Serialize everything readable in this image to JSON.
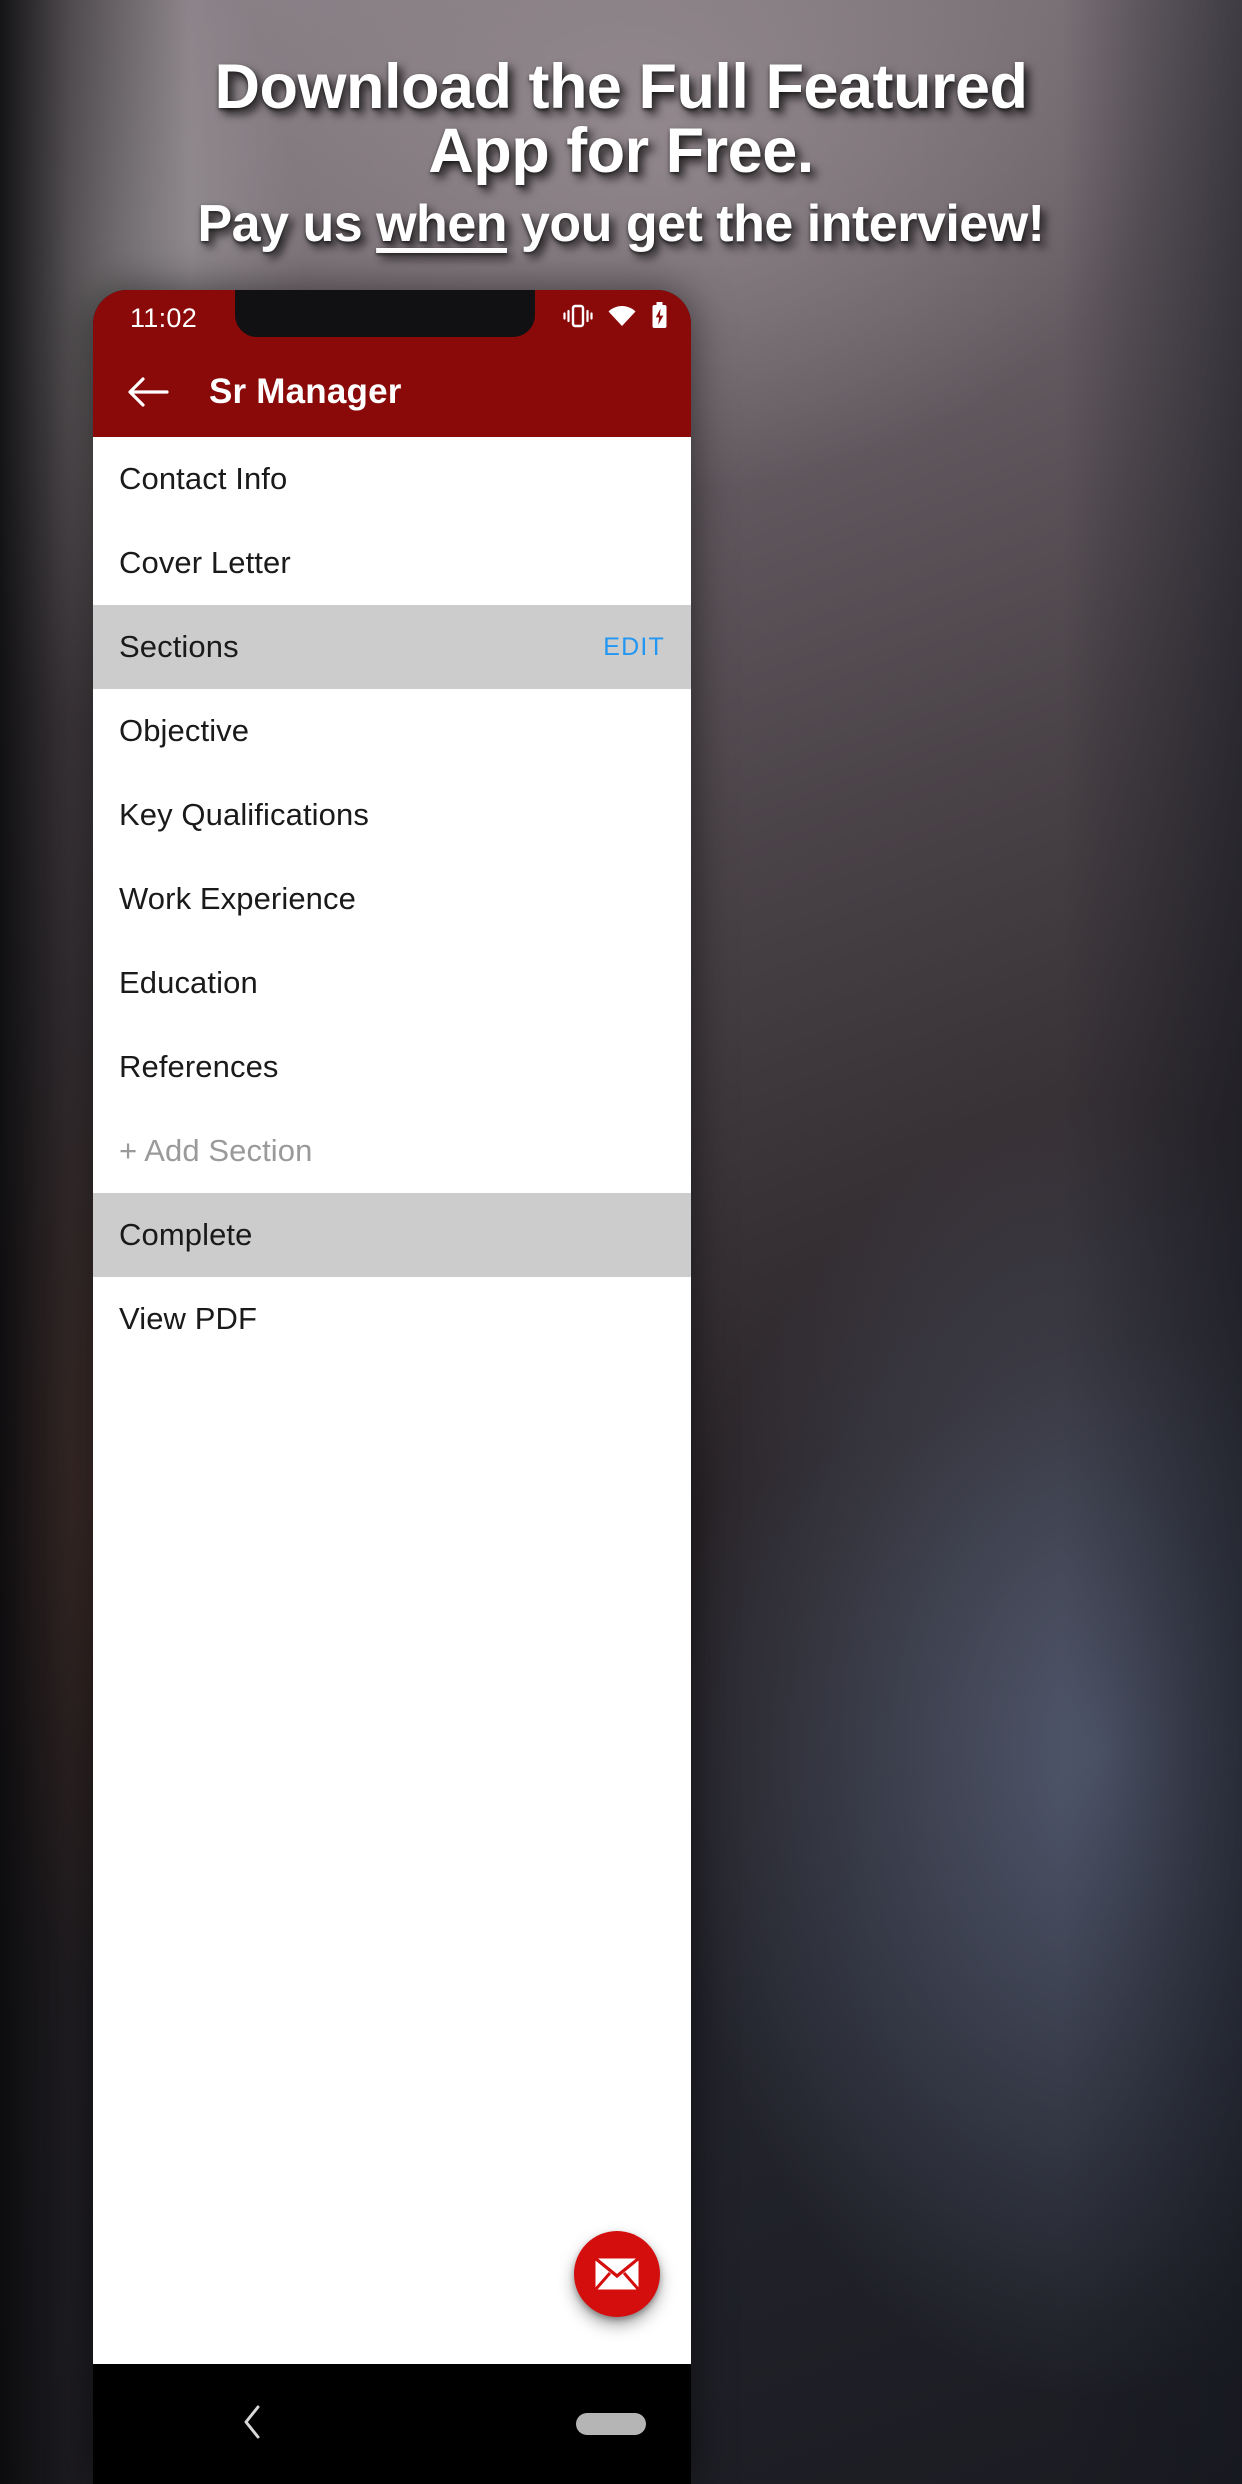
{
  "promo": {
    "line1": "Download the Full Featured",
    "line2": "App for Free.",
    "line3_before": "Pay us ",
    "line3_underlined": "when",
    "line3_after": " you get the interview!"
  },
  "phone": {
    "status_bar": {
      "time": "11:02",
      "icons": [
        "vibrate-icon",
        "wifi-icon",
        "battery-charging-icon"
      ]
    },
    "app_bar": {
      "back_icon": "back-arrow-icon",
      "title": "Sr Manager",
      "background_color": "#8a0a0a"
    },
    "list": [
      {
        "label": "Contact Info",
        "type": "item"
      },
      {
        "label": "Cover Letter",
        "type": "item"
      },
      {
        "label": "Sections",
        "type": "header",
        "action": "EDIT",
        "action_color": "#2196f3"
      },
      {
        "label": "Objective",
        "type": "item"
      },
      {
        "label": "Key Qualifications",
        "type": "item"
      },
      {
        "label": "Work Experience",
        "type": "item"
      },
      {
        "label": "Education",
        "type": "item"
      },
      {
        "label": "References",
        "type": "item"
      },
      {
        "label": "+ Add Section",
        "type": "muted"
      },
      {
        "label": "Complete",
        "type": "header"
      },
      {
        "label": "View PDF",
        "type": "item"
      }
    ],
    "fab": {
      "icon": "email-icon",
      "color": "#d40d0d"
    },
    "nav_bar": {
      "back_icon": "chevron-left-icon",
      "home_pill": "home-pill"
    }
  }
}
